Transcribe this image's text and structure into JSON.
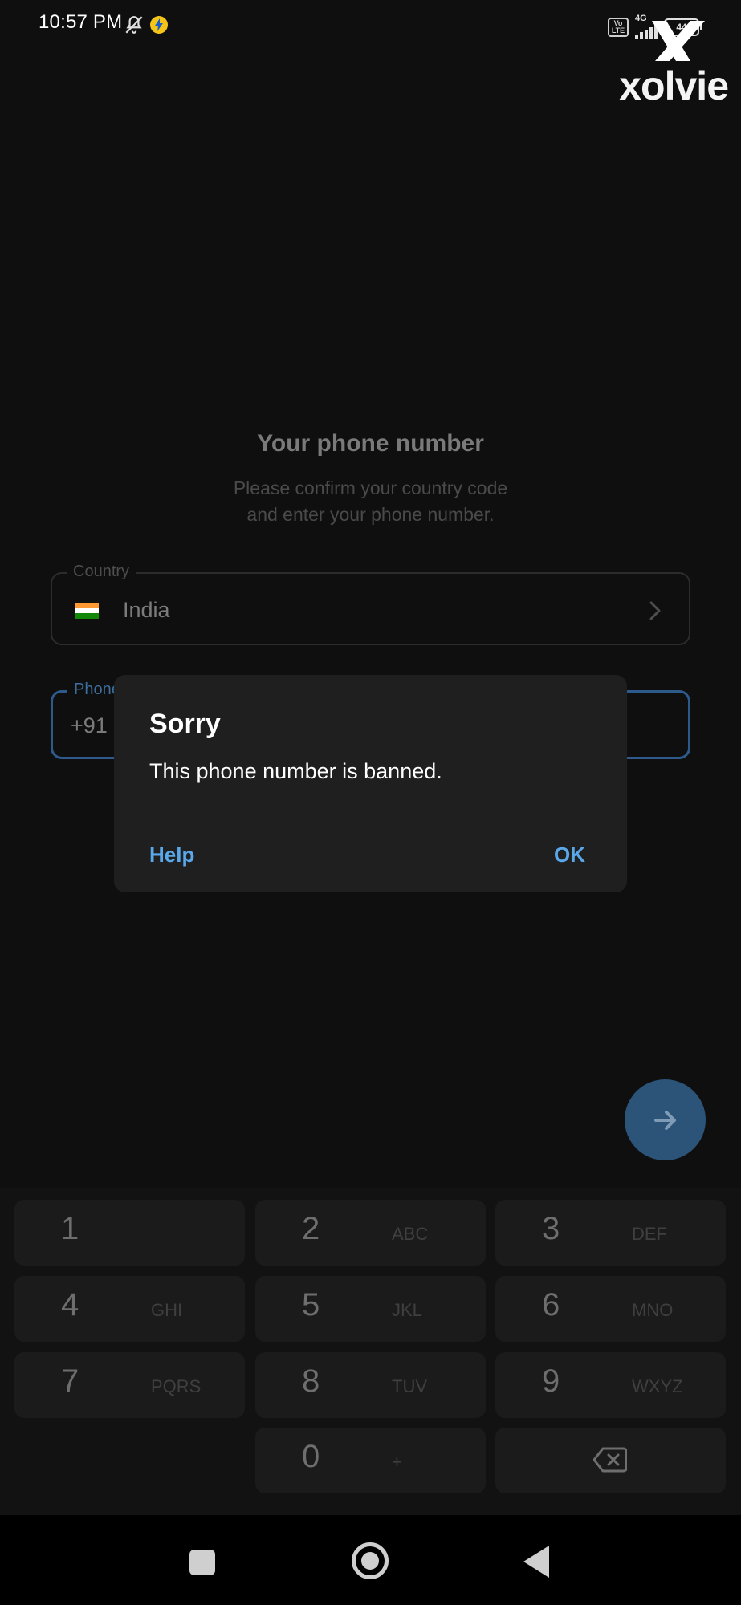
{
  "status_bar": {
    "time": "10:57 PM",
    "network": "4G",
    "volte": "Vo LTE",
    "battery": "44",
    "icons": [
      "bell-off-icon",
      "lightning-app-icon",
      "volte-icon",
      "signal-icon",
      "battery-icon"
    ]
  },
  "watermark": {
    "text": "xolvie"
  },
  "header": {
    "title": "Your phone number",
    "subtitle_line1": "Please confirm your country code",
    "subtitle_line2": "and enter your phone number."
  },
  "country_field": {
    "label": "Country",
    "value": "India",
    "flag": "india-flag-icon"
  },
  "phone_field": {
    "label": "Phone",
    "country_code": "+91"
  },
  "dialog": {
    "title": "Sorry",
    "message": "This phone number is banned.",
    "help_label": "Help",
    "ok_label": "OK"
  },
  "fab": {
    "icon": "arrow-right-icon"
  },
  "keypad": {
    "keys": [
      {
        "digit": "1",
        "letters": ""
      },
      {
        "digit": "2",
        "letters": "ABC"
      },
      {
        "digit": "3",
        "letters": "DEF"
      },
      {
        "digit": "4",
        "letters": "GHI"
      },
      {
        "digit": "5",
        "letters": "JKL"
      },
      {
        "digit": "6",
        "letters": "MNO"
      },
      {
        "digit": "7",
        "letters": "PQRS"
      },
      {
        "digit": "8",
        "letters": "TUV"
      },
      {
        "digit": "9",
        "letters": "WXYZ"
      },
      {
        "digit": "0",
        "letters": "+"
      }
    ],
    "backspace_icon": "backspace-icon"
  },
  "colors": {
    "background": "#0f0f0f",
    "dialog_background": "#1f1f1f",
    "accent": "#5aa7ea",
    "fab": "#2c5378"
  }
}
